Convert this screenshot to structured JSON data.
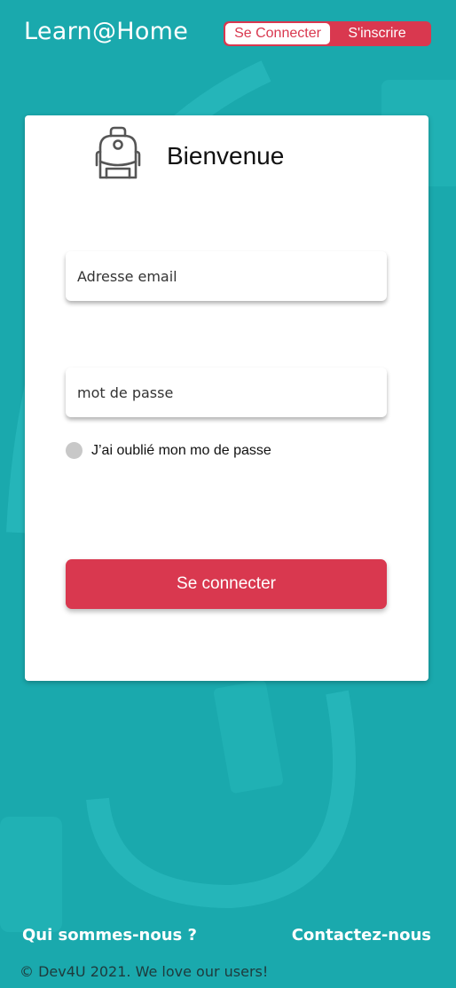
{
  "header": {
    "logo": "Learn@Home",
    "login_tab": "Se Connecter",
    "signup_tab": "S'inscrire"
  },
  "card": {
    "icon": "backpack-icon",
    "title": "Bienvenue",
    "email_placeholder": "Adresse email",
    "password_placeholder": "mot de passe",
    "forgot_label": "J’ai oublié mon mo de passe",
    "submit_label": "Se connecter"
  },
  "footer": {
    "about_link": "Qui sommes-nous ?",
    "contact_link": "Contactez-nous",
    "copyright": "© Dev4U 2021. We love our users!"
  },
  "colors": {
    "background": "#1aa9ad",
    "accent": "#d9384f",
    "card": "#ffffff"
  }
}
